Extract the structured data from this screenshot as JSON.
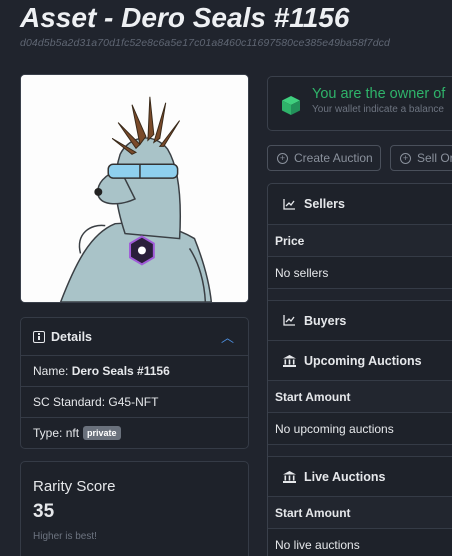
{
  "page": {
    "title": "Asset - Dero Seals #1156",
    "hash": "d04d5b5a2d31a70d1fc52e8c6a5e17c01a8460c11697580ce385e49ba58f7dcd"
  },
  "details": {
    "header": "Details",
    "name_label": "Name:",
    "name_value": "Dero Seals #1156",
    "standard_label": "SC Standard:",
    "standard_value": "G45-NFT",
    "type_label": "Type:",
    "type_value": "nft",
    "type_badge": "private"
  },
  "rarity": {
    "label": "Rarity Score",
    "value": "35",
    "note": "Higher is best!"
  },
  "owner": {
    "title": "You are the owner of",
    "subtitle": "Your wallet indicate a balance"
  },
  "actions": {
    "create_auction": "Create Auction",
    "sell": "Sell Or"
  },
  "sellers": {
    "header": "Sellers",
    "column": "Price",
    "empty": "No sellers"
  },
  "buyers": {
    "header": "Buyers"
  },
  "upcoming": {
    "header": "Upcoming Auctions",
    "column": "Start Amount",
    "empty": "No upcoming auctions"
  },
  "live": {
    "header": "Live Auctions",
    "column": "Start Amount",
    "empty": "No live auctions"
  },
  "colors": {
    "background": "#20242d",
    "accent_green": "#2fb36a",
    "accent_blue": "#4d8fe0"
  },
  "icons": {
    "chevron": "chevron-up-icon",
    "sellers": "line-chart-icon",
    "buyers": "line-chart-icon",
    "auctions": "bank-icon",
    "owner": "cube-icon"
  }
}
